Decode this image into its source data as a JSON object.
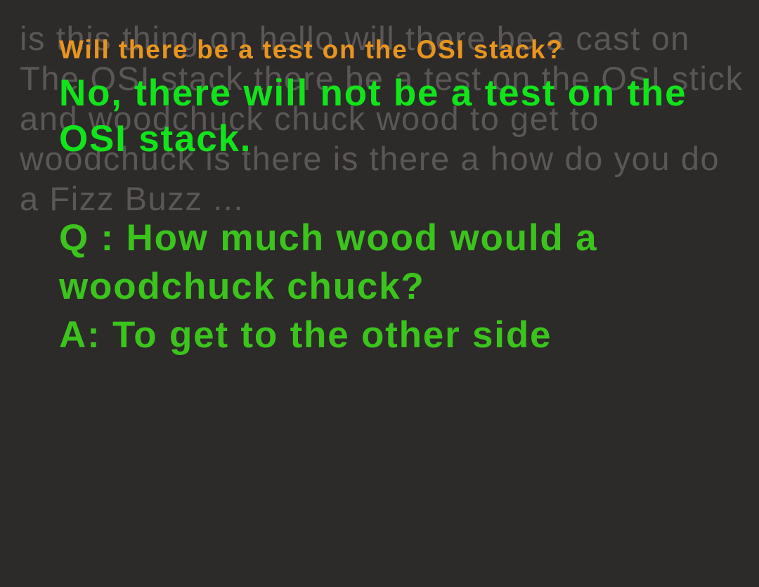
{
  "transcript": {
    "background_text": "is this thing on hello will there be a cast on The OSI stack there be a test on the OSI stick and woodchuck chuck wood to get to woodchuck is there is there a how do you do a Fizz Buzz ..."
  },
  "current": {
    "question": "Will there be a test on the OSI stack?",
    "answer": "No, there will not be a test on the OSI stack."
  },
  "qa": {
    "question": "Q : How much wood would a woodchuck chuck?",
    "answer": "A: To get to the other side"
  },
  "colors": {
    "background": "#2d2a2a",
    "transcript": "#5b5757",
    "current_question": "#e8951f",
    "current_answer": "#11e41a",
    "qa_text": "#3bc41c"
  }
}
